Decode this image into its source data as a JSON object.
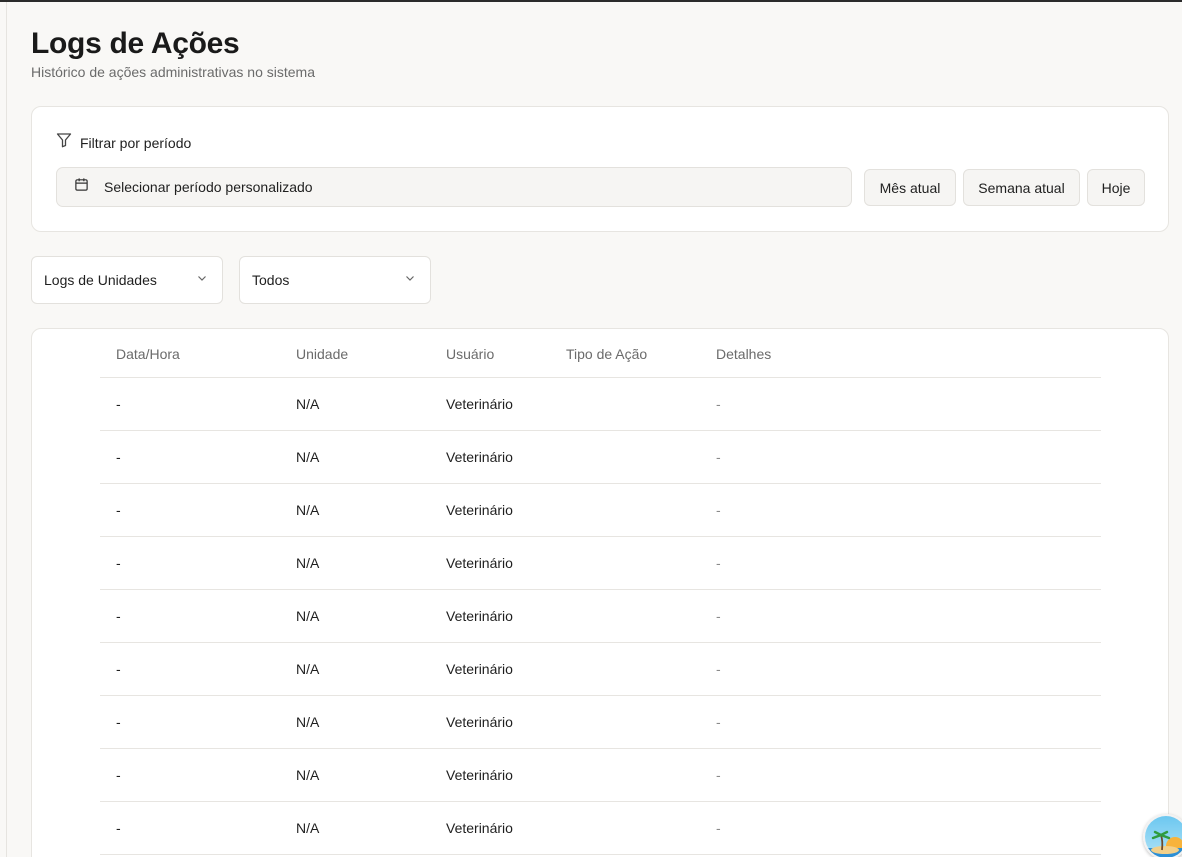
{
  "header": {
    "title": "Logs de Ações",
    "subtitle": "Histórico de ações administrativas no sistema"
  },
  "filter": {
    "label": "Filtrar por período",
    "period_placeholder": "Selecionar período personalizado",
    "quick": {
      "month": "Mês atual",
      "week": "Semana atual",
      "today": "Hoje"
    }
  },
  "selects": {
    "log_type": "Logs de Unidades",
    "scope": "Todos"
  },
  "table": {
    "columns": [
      "Data/Hora",
      "Unidade",
      "Usuário",
      "Tipo de Ação",
      "Detalhes"
    ],
    "rows": [
      [
        "-",
        "N/A",
        "Veterinário",
        "",
        "-"
      ],
      [
        "-",
        "N/A",
        "Veterinário",
        "",
        "-"
      ],
      [
        "-",
        "N/A",
        "Veterinário",
        "",
        "-"
      ],
      [
        "-",
        "N/A",
        "Veterinário",
        "",
        "-"
      ],
      [
        "-",
        "N/A",
        "Veterinário",
        "",
        "-"
      ],
      [
        "-",
        "N/A",
        "Veterinário",
        "",
        "-"
      ],
      [
        "-",
        "N/A",
        "Veterinário",
        "",
        "-"
      ],
      [
        "-",
        "N/A",
        "Veterinário",
        "",
        "-"
      ],
      [
        "-",
        "N/A",
        "Veterinário",
        "",
        "-"
      ]
    ]
  },
  "icons": {
    "filter": "filter-icon",
    "calendar": "calendar-icon",
    "chevron": "chevron-down-icon",
    "corner": "island-avatar-icon"
  }
}
